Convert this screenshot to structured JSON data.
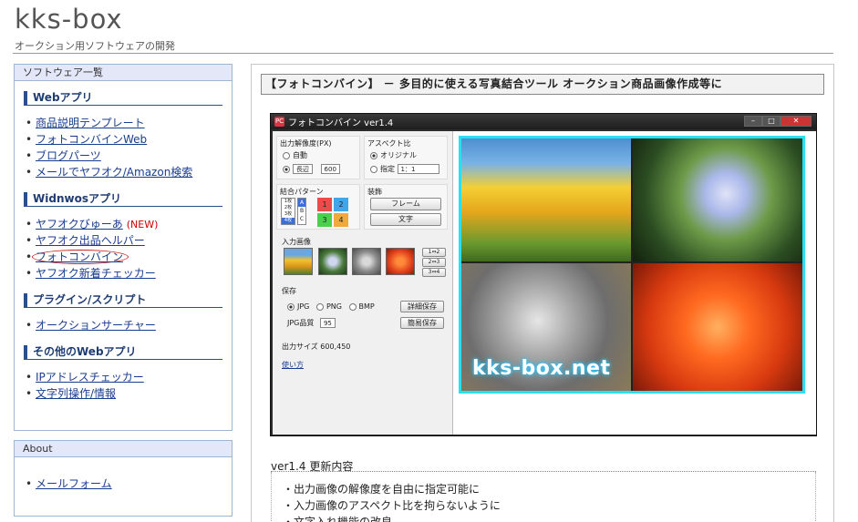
{
  "site": {
    "title": "kks-box",
    "subtitle": "オークション用ソフトウェアの開発"
  },
  "sidebar": {
    "software_head": "ソフトウェア一覧",
    "categories": [
      {
        "title": "Webアプリ",
        "items": [
          "商品説明テンプレート",
          "フォトコンバインWeb",
          "ブログパーツ",
          "メールでヤフオク/Amazon検索"
        ]
      },
      {
        "title": "Widnwosアプリ",
        "items": [
          "ヤフオクびゅーあ",
          "ヤフオク出品ヘルパー",
          "フォトコンバイン",
          "ヤフオク新着チェッカー"
        ],
        "new_badge": "(NEW)"
      },
      {
        "title": "プラグイン/スクリプト",
        "items": [
          "オークションサーチャー"
        ]
      },
      {
        "title": "その他のWebアプリ",
        "items": [
          "IPアドレスチェッカー",
          "文字列操作/情報"
        ]
      }
    ],
    "about_head": "About",
    "about_items": [
      "メールフォーム"
    ]
  },
  "main": {
    "title": "【フォトコンバイン】 － 多目的に使える写真結合ツール オークション商品画像作成等に"
  },
  "app": {
    "window_title": "フォトコンバイン ver1.4",
    "icon_label": "PC",
    "resolution_label": "出力解像度(PX)",
    "auto_label": "自動",
    "long_side_label": "長辺",
    "long_side_value": "600",
    "aspect_label": "アスペクト比",
    "original_label": "オリジナル",
    "specify_label": "指定",
    "ratio_value": "1：1",
    "pattern_label": "結合パターン",
    "pattern_numbers": [
      "1",
      "2",
      "3",
      "4"
    ],
    "pattern_letters": [
      "A",
      "B",
      "C"
    ],
    "pattern_mini": [
      "1枚",
      "2枚",
      "3枚",
      "4枚"
    ],
    "decor_label": "装飾",
    "frame_button": "フレーム",
    "text_button": "文字",
    "input_label": "入力画像",
    "swap_buttons": [
      "1⇔2",
      "2⇔3",
      "3⇔4"
    ],
    "save_label": "保存",
    "formats": [
      "JPG",
      "PNG",
      "BMP"
    ],
    "detail_save_button": "詳細保存",
    "quality_label": "JPG品質",
    "quality_value": "95",
    "quick_save_button": "簡易保存",
    "output_size": "出力サイズ 600,450",
    "usage_link": "使い方",
    "watermark": "kks-box.net"
  },
  "changelog": {
    "heading": "ver1.4 更新内容",
    "items": [
      "・出力画像の解像度を自由に指定可能に",
      "・入力画像のアスペクト比を拘らないように",
      "・文字入れ機能の改良"
    ]
  },
  "colors": {
    "link": "#1a3d8f",
    "frame_cyan": "#29e0f0",
    "sidebar_head_bg": "#e3e7f8",
    "category_accent": "#2b4f8c"
  }
}
